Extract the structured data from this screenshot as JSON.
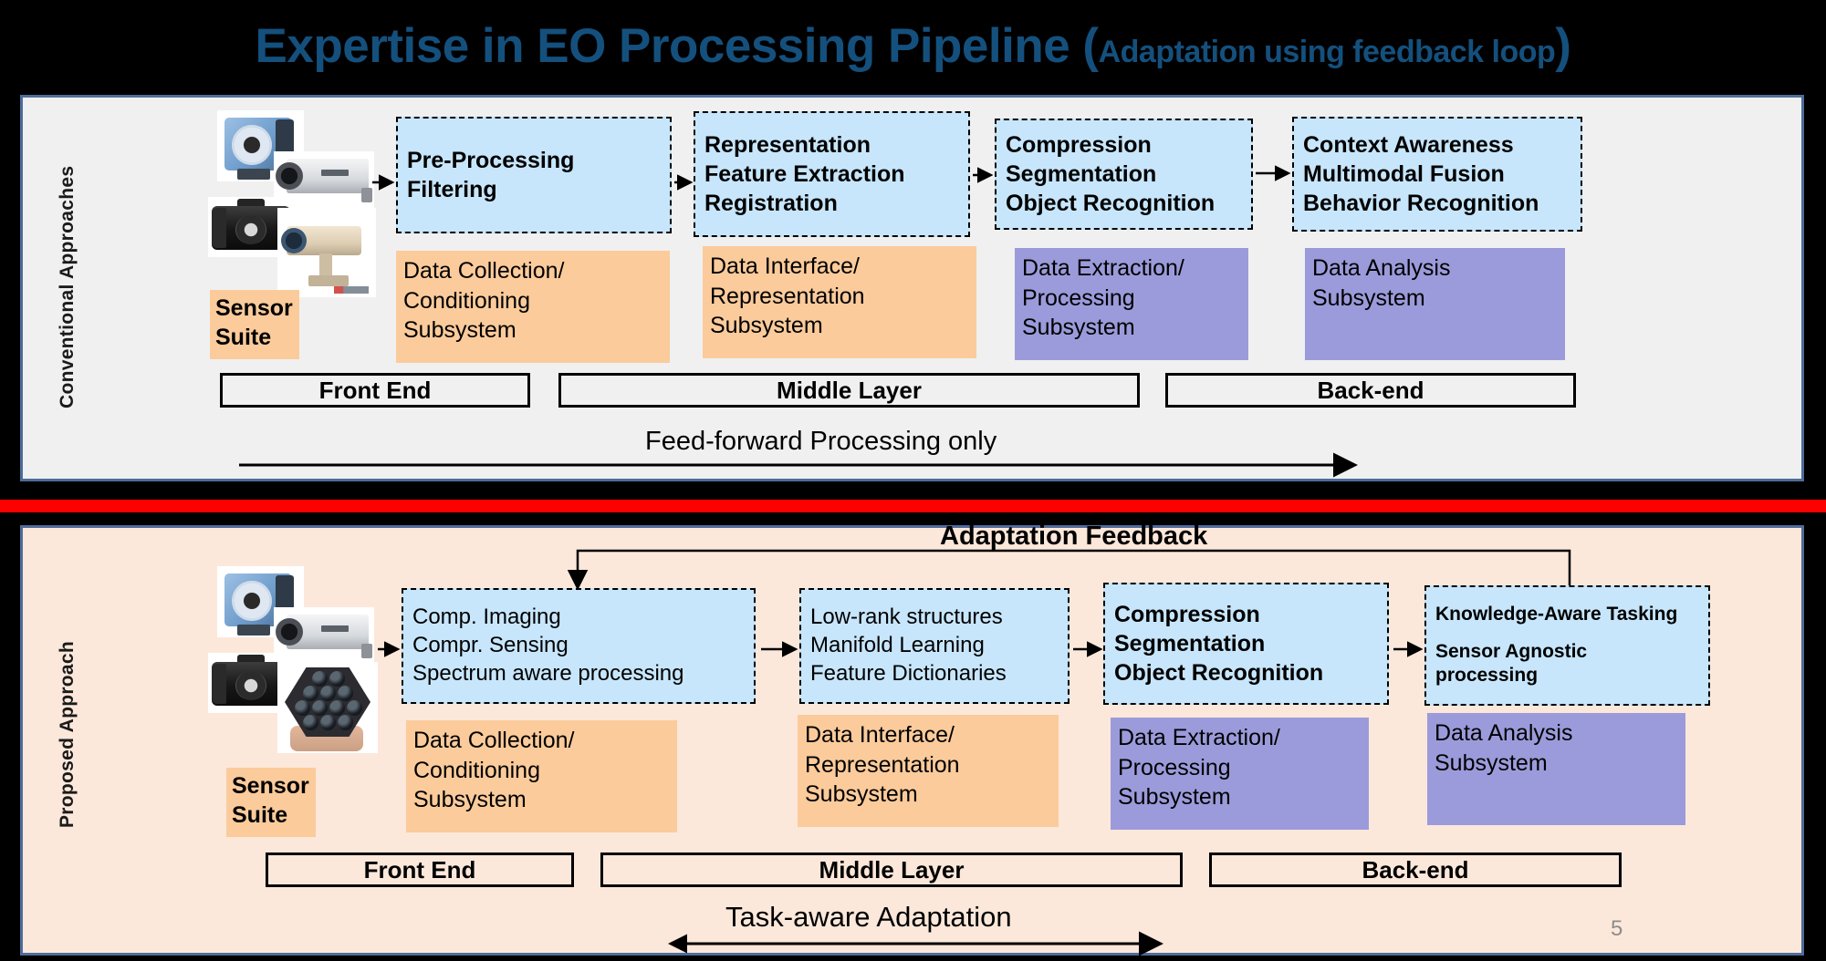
{
  "title": {
    "main": "Expertise in EO Processing Pipeline (",
    "sub": "Adaptation using feedback loop",
    "close": ")"
  },
  "colors": {
    "title": "#14507d",
    "panel_top_bg": "#f0f0f0",
    "panel_bottom_bg": "#fce8da",
    "panel_border": "#4e6c9b",
    "divider_red": "#ff0000",
    "process_box": "#c7e6fb",
    "orange_box": "#fbcb9b",
    "purple_box": "#9b9bdb",
    "page_number": "#8c8c8c"
  },
  "top_panel": {
    "side_label": "Conventional Approaches",
    "sensor_suite": {
      "line1": "Sensor",
      "line2": "Suite"
    },
    "process_boxes": [
      {
        "line1": "Pre-Processing",
        "line2": "Filtering",
        "line3": ""
      },
      {
        "line1": "Representation",
        "line2": "Feature Extraction",
        "line3": " Registration"
      },
      {
        "line1": "Compression",
        "line2": "Segmentation",
        "line3": "Object Recognition"
      },
      {
        "line1": "Context Awareness",
        "line2": "Multimodal Fusion",
        "line3": "Behavior Recognition"
      }
    ],
    "subsystems": [
      {
        "line1": "Data Collection/",
        "line2": "Conditioning",
        "line3": "Subsystem",
        "color": "orange"
      },
      {
        "line1": "Data Interface/",
        "line2": "Representation",
        "line3": "Subsystem",
        "color": "orange"
      },
      {
        "line1": "Data Extraction/",
        "line2": "Processing",
        "line3": "Subsystem",
        "color": "purple"
      },
      {
        "line1": "Data Analysis",
        "line2": "Subsystem",
        "line3": "",
        "color": "purple"
      }
    ],
    "layers": [
      "Front End",
      "Middle Layer",
      "Back-end"
    ],
    "flow_caption": "Feed-forward  Processing  only"
  },
  "bottom_panel": {
    "side_label": "Proposed Approach",
    "feedback_caption": "Adaptation Feedback",
    "sensor_suite": {
      "line1": "Sensor",
      "line2": "Suite"
    },
    "process_boxes": [
      {
        "line1": "Comp.  Imaging",
        "line2": "Compr. Sensing",
        "line3": "Spectrum aware processing"
      },
      {
        "line1": "Low-rank structures",
        "line2": "Manifold Learning",
        "line3": "Feature Dictionaries"
      },
      {
        "line1": "Compression",
        "line2": "Segmentation",
        "line3": "Object Recognition"
      },
      {
        "line1": "Knowledge-Aware Tasking",
        "line2": "Sensor Agnostic",
        "line3": "processing"
      }
    ],
    "subsystems": [
      {
        "line1": "Data Collection/",
        "line2": "Conditioning",
        "line3": "Subsystem",
        "color": "orange"
      },
      {
        "line1": "Data Interface/",
        "line2": "Representation",
        "line3": "Subsystem",
        "color": "orange"
      },
      {
        "line1": "Data Extraction/",
        "line2": "Processing",
        "line3": "Subsystem",
        "color": "purple"
      },
      {
        "line1": "Data Analysis",
        "line2": "Subsystem",
        "line3": "",
        "color": "purple"
      }
    ],
    "layers": [
      "Front End",
      "Middle Layer",
      "Back-end"
    ],
    "flow_caption": "Task-aware Adaptation"
  },
  "page_number": "5"
}
